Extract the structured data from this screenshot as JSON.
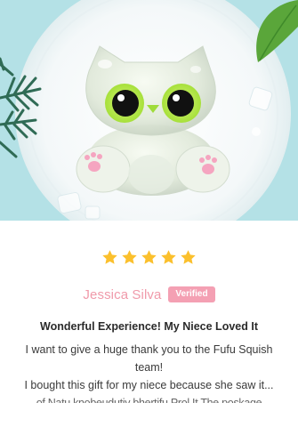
{
  "review": {
    "rating": 5,
    "rating_max": 5,
    "author": "Jessica Silva",
    "badge": "Verified",
    "title": "Wonderful Experience! My Niece Loved It",
    "lines": [
      "I want to give a huge thank you to the Fufu Squish team!",
      "I bought this gift for my niece because she saw it...",
      "of Natu knobeudutiy bhertifu Prol It The poskage"
    ]
  },
  "colors": {
    "star": "#fbc02d",
    "author": "#f09aaa",
    "badge_bg": "#f4a0b3",
    "photo_bg": "#a9dde3"
  },
  "icons": {
    "rating": "star-icon"
  }
}
